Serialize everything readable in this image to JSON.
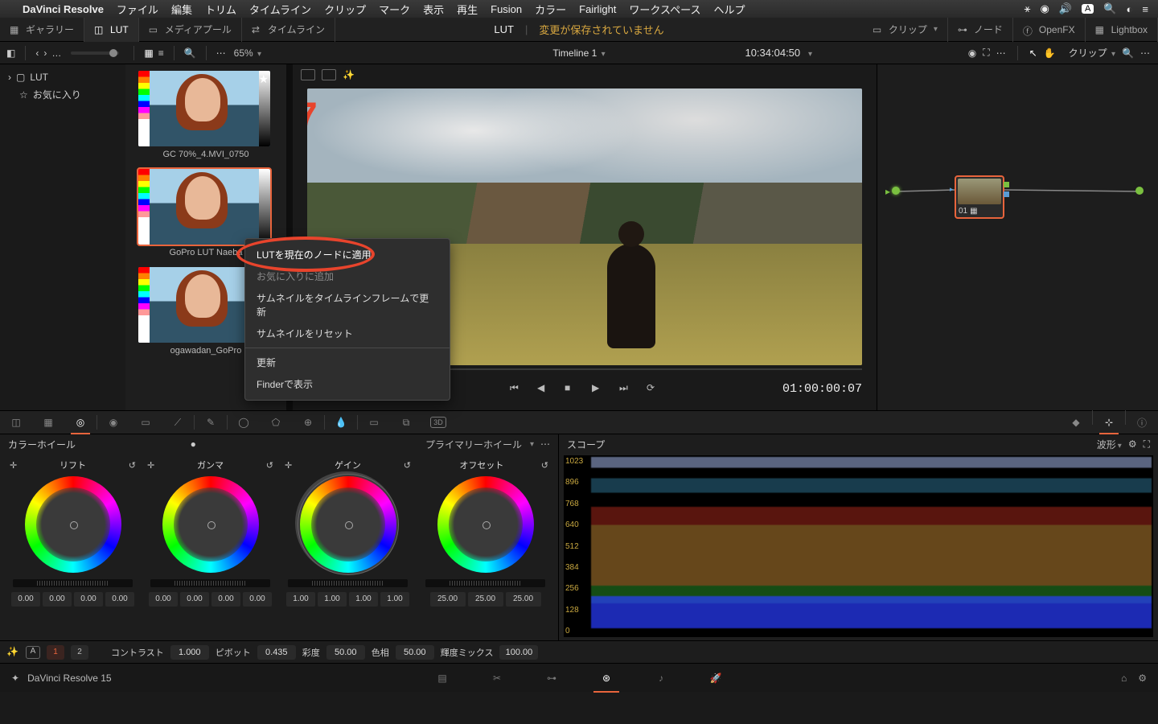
{
  "menubar": {
    "app_name": "DaVinci Resolve",
    "items": [
      "ファイル",
      "編集",
      "トリム",
      "タイムライン",
      "クリップ",
      "マーク",
      "表示",
      "再生",
      "Fusion",
      "カラー",
      "Fairlight",
      "ワークスペース",
      "ヘルプ"
    ],
    "right_badge": "A"
  },
  "toolbar1": {
    "gallery": "ギャラリー",
    "lut": "LUT",
    "mediapool": "メディアプール",
    "timeline": "タイムライン",
    "center_lut": "LUT",
    "unsaved": "変更が保存されていません",
    "clips": "クリップ",
    "nodes": "ノード",
    "openfx": "OpenFX",
    "lightbox": "Lightbox"
  },
  "toolbar2": {
    "breadcrumb": "…",
    "zoom": "65%",
    "timeline_name": "Timeline 1",
    "timecode": "10:34:04:50",
    "clips": "クリップ"
  },
  "sidebar": {
    "lut": "LUT",
    "favorites": "お気に入り"
  },
  "thumbs": [
    {
      "label": "GC 70%_4.MVI_0750",
      "starred": true
    },
    {
      "label": "GoPro LUT Naeba",
      "selected": true
    },
    {
      "label": "ogawadan_GoPro"
    }
  ],
  "annotation_number": "7",
  "context_menu": {
    "apply": "LUTを現在のノードに適用",
    "add_fav": "お気に入りに追加",
    "update_thumb": "サムネイルをタイムラインフレームで更新",
    "reset_thumb": "サムネイルをリセット",
    "refresh": "更新",
    "finder": "Finderで表示"
  },
  "transport": {
    "timecode": "01:00:00:07"
  },
  "node": {
    "label": "01"
  },
  "nodes_top": {
    "clips": "クリップ"
  },
  "wheels": {
    "panel_title": "カラーホイール",
    "mode": "プライマリーホイール",
    "lift": {
      "name": "リフト",
      "vals": [
        "0.00",
        "0.00",
        "0.00",
        "0.00"
      ]
    },
    "gamma": {
      "name": "ガンマ",
      "vals": [
        "0.00",
        "0.00",
        "0.00",
        "0.00"
      ]
    },
    "gain": {
      "name": "ゲイン",
      "vals": [
        "1.00",
        "1.00",
        "1.00",
        "1.00"
      ]
    },
    "offset": {
      "name": "オフセット",
      "vals": [
        "25.00",
        "25.00",
        "25.00"
      ]
    }
  },
  "scope": {
    "title": "スコープ",
    "mode": "波形",
    "ticks": [
      "1023",
      "896",
      "768",
      "640",
      "512",
      "384",
      "256",
      "128",
      "0"
    ]
  },
  "adjust": {
    "tab1": "1",
    "tab2": "2",
    "contrast_l": "コントラスト",
    "contrast_v": "1.000",
    "pivot_l": "ピボット",
    "pivot_v": "0.435",
    "sat_l": "彩度",
    "sat_v": "50.00",
    "hue_l": "色相",
    "hue_v": "50.00",
    "lummix_l": "輝度ミックス",
    "lummix_v": "100.00"
  },
  "footer": {
    "app": "DaVinci Resolve 15"
  }
}
